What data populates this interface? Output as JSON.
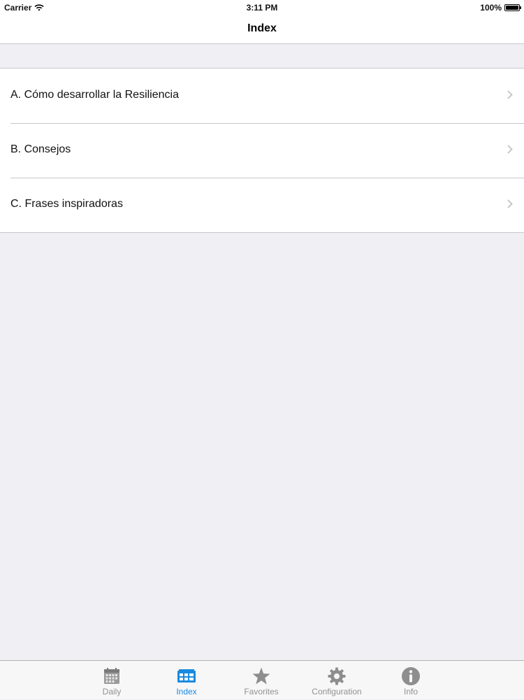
{
  "status_bar": {
    "carrier": "Carrier",
    "time": "3:11 PM",
    "battery": "100%"
  },
  "nav": {
    "title": "Index"
  },
  "list": {
    "items": [
      {
        "label": "A. Cómo desarrollar la Resiliencia"
      },
      {
        "label": "B. Consejos"
      },
      {
        "label": "C. Frases inspiradoras"
      }
    ]
  },
  "tabs": [
    {
      "label": "Daily",
      "icon": "calendar-icon",
      "active": false
    },
    {
      "label": "Index",
      "icon": "index-icon",
      "active": true
    },
    {
      "label": "Favorites",
      "icon": "star-icon",
      "active": false
    },
    {
      "label": "Configuration",
      "icon": "gear-icon",
      "active": false
    },
    {
      "label": "Info",
      "icon": "info-icon",
      "active": false
    }
  ],
  "colors": {
    "active_tint": "#1a8ae0",
    "inactive_tint": "#929292",
    "background": "#efeff4"
  }
}
